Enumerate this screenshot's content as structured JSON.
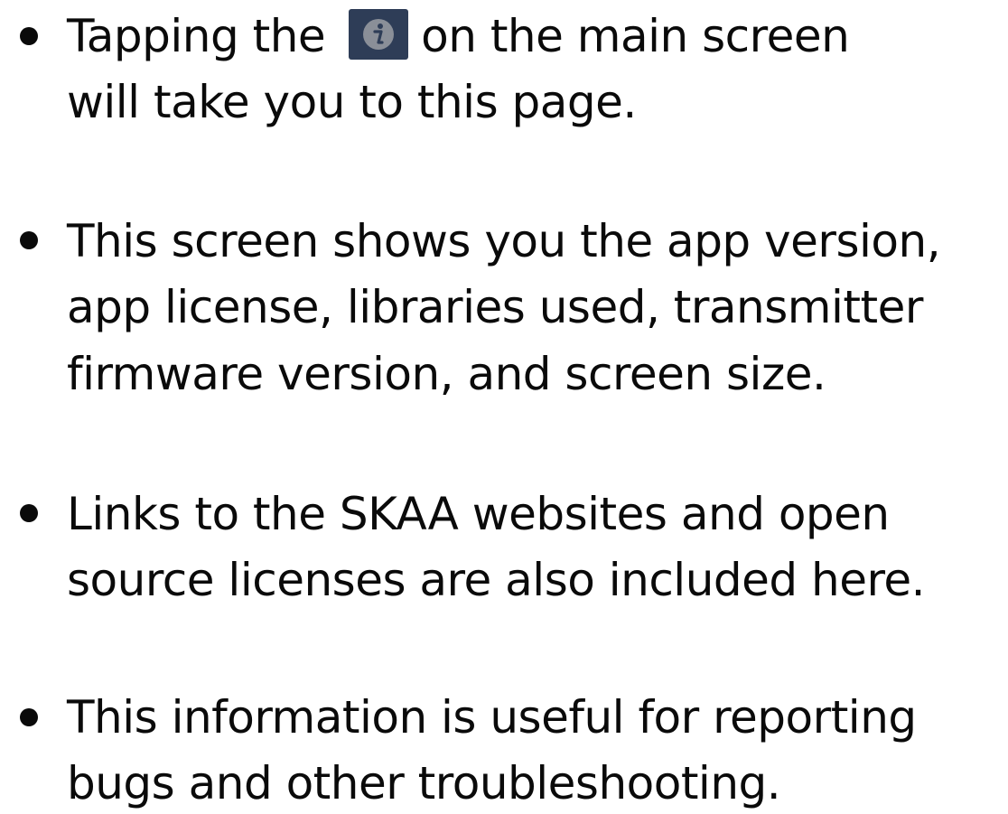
{
  "items": [
    {
      "lines": [
        "Tapping the",
        "on the main screen",
        "will take you to this page."
      ],
      "icon": "info-icon"
    },
    {
      "lines": [
        "This screen shows you the app version,",
        "app license, libraries used, transmitter",
        "firmware version, and screen size."
      ]
    },
    {
      "lines": [
        "Links to the SKAA websites and open",
        "source licenses are also included here."
      ]
    },
    {
      "lines": [
        "This information is useful for reporting",
        "bugs and other troubleshooting."
      ]
    }
  ],
  "colors": {
    "text": "#0a0a0a",
    "icon_background": "#2e3d57",
    "icon_circle": "#8a8f98"
  }
}
